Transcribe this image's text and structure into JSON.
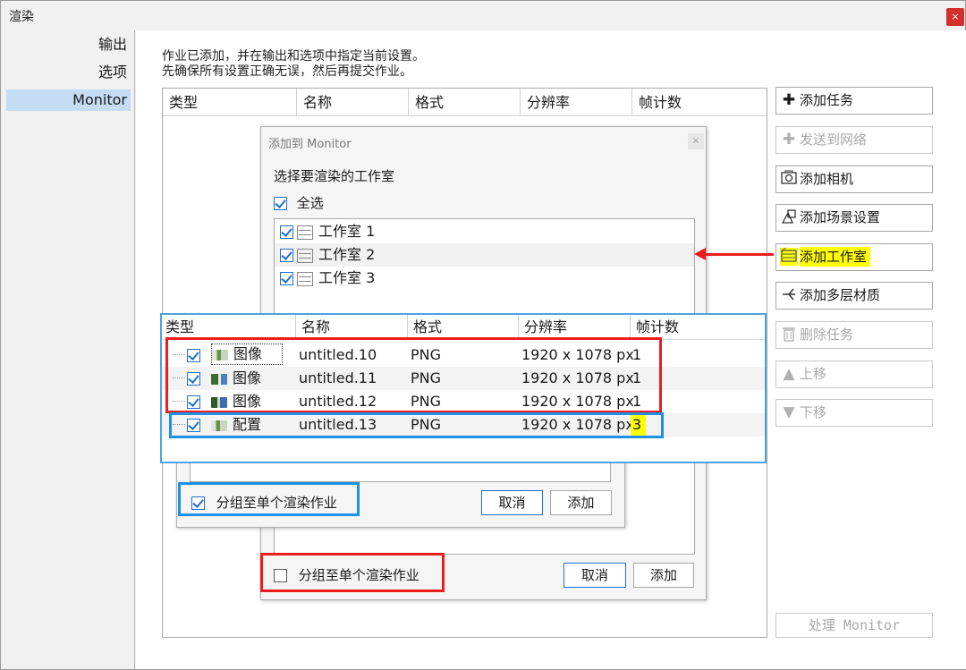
{
  "window": {
    "title": "渲染",
    "close_glyph": "×"
  },
  "sidebar": {
    "items": [
      {
        "label": "输出"
      },
      {
        "label": "选项"
      },
      {
        "label": "Monitor"
      }
    ]
  },
  "description": {
    "line1": "作业已添加，并在输出和选项中指定当前设置。",
    "line2": "先确保所有设置正确无误，然后再提交作业。"
  },
  "main_table": {
    "columns": [
      "类型",
      "名称",
      "格式",
      "分辨率",
      "帧计数"
    ]
  },
  "right_panel": {
    "buttons": [
      {
        "label": "添加任务",
        "icon": "plus-icon",
        "enabled": true
      },
      {
        "label": "发送到网络",
        "icon": "plus-icon",
        "enabled": false
      },
      {
        "label": "添加相机",
        "icon": "camera-icon",
        "enabled": true
      },
      {
        "label": "添加场景设置",
        "icon": "shapes-icon",
        "enabled": true
      },
      {
        "label": "添加工作室",
        "icon": "studio-icon",
        "enabled": true,
        "highlight": "#ffff00"
      },
      {
        "label": "添加多层材质",
        "icon": "layers-icon",
        "enabled": true
      },
      {
        "label": "删除任务",
        "icon": "trash-icon",
        "enabled": false
      },
      {
        "label": "上移",
        "icon": "arrow-up-icon",
        "enabled": false
      },
      {
        "label": "下移",
        "icon": "arrow-down-icon",
        "enabled": false
      }
    ],
    "process_button": "处理 Monitor"
  },
  "add_dialog": {
    "title": "添加到 Monitor",
    "close_glyph": "×",
    "prompt": "选择要渲染的工作室",
    "select_all": "全选",
    "studios": [
      {
        "label": "工作室 1",
        "checked": true
      },
      {
        "label": "工作室 2",
        "checked": true
      },
      {
        "label": "工作室 3",
        "checked": true
      }
    ],
    "group_checkbox": {
      "label": "分组至单个渲染作业",
      "checked": false
    },
    "cancel": "取消",
    "add": "添加"
  },
  "camera_dialog": {
    "columns": [
      "类型",
      "名称",
      "格式",
      "分辨率",
      "帧计数"
    ],
    "rows": [
      {
        "type": "图像",
        "name": "untitled.10",
        "format": "PNG",
        "resolution": "1920 x 1078 px",
        "frames": "1"
      },
      {
        "type": "图像",
        "name": "untitled.11",
        "format": "PNG",
        "resolution": "1920 x 1078 px",
        "frames": "1"
      },
      {
        "type": "图像",
        "name": "untitled.12",
        "format": "PNG",
        "resolution": "1920 x 1078 px",
        "frames": "1"
      },
      {
        "type": "配置",
        "name": "untitled.13",
        "format": "PNG",
        "resolution": "1920 x 1078 px",
        "frames": "3"
      }
    ],
    "group_checkbox": {
      "label": "分组至单个渲染作业",
      "checked": true
    },
    "cancel": "取消",
    "add": "添加"
  },
  "colors": {
    "annotation_red": "#ee1c1c",
    "annotation_blue": "#1e90e6",
    "highlight_yellow": "#ffff00",
    "selection_blue": "#c4dcf4"
  }
}
